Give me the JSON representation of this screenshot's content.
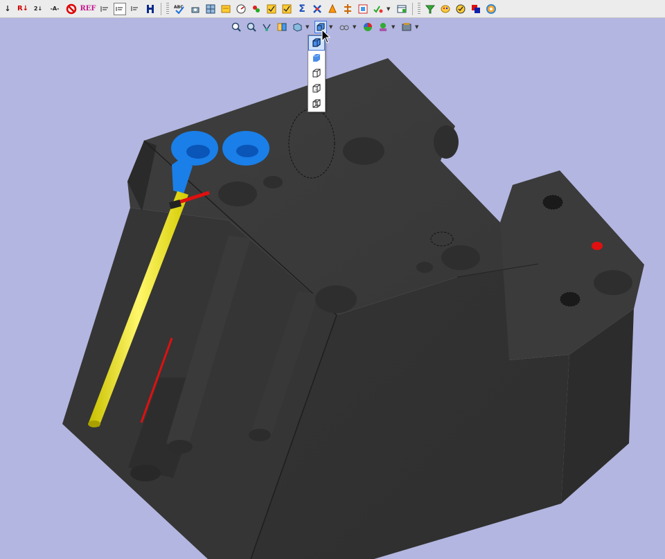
{
  "toolbar": {
    "text_buttons": {
      "r_arrow": "R↓",
      "sort": "2↓",
      "dash_a": "-A-",
      "ref": "REF",
      "sigma": "Σ",
      "abc": "ABC"
    },
    "icons": [
      "arrow-down-icon",
      "r-arrow-icon",
      "sort-icon",
      "dash-a-icon",
      "no-entry-icon",
      "ref-icon",
      "align-left-icon",
      "align-frame-icon",
      "align-small-icon",
      "hierarchy-icon",
      "spell-check-icon",
      "measure-icon",
      "scale-icon",
      "note-icon",
      "gauge-icon",
      "checkbox-icon",
      "checkbox-2-icon",
      "sigma-icon",
      "tools-icon",
      "cone-icon",
      "split-icon",
      "grid-icon",
      "check-sort-icon",
      "table-icon",
      "filter-icon",
      "palette-icon",
      "check-circle-icon",
      "color-swatch-icon",
      "color-wheel-icon"
    ]
  },
  "view_toolbar": {
    "icons": [
      "zoom-fit-icon",
      "zoom-icon",
      "rotate-icon",
      "section-icon",
      "view-orient-icon",
      "display-style-icon",
      "hide-show-icon",
      "appearance-icon",
      "scene-icon",
      "view-settings-icon"
    ]
  },
  "display_menu": {
    "items": [
      "shaded-with-edges-icon",
      "shaded-icon",
      "hidden-lines-removed-icon",
      "hidden-lines-visible-icon",
      "wireframe-icon"
    ],
    "active_index": 0
  },
  "colors": {
    "viewport_bg": "#b3b6e0",
    "body": "#3c3c3c",
    "blue": "#1a7fe8",
    "yellow": "#f5ea00",
    "red": "#e01010"
  }
}
